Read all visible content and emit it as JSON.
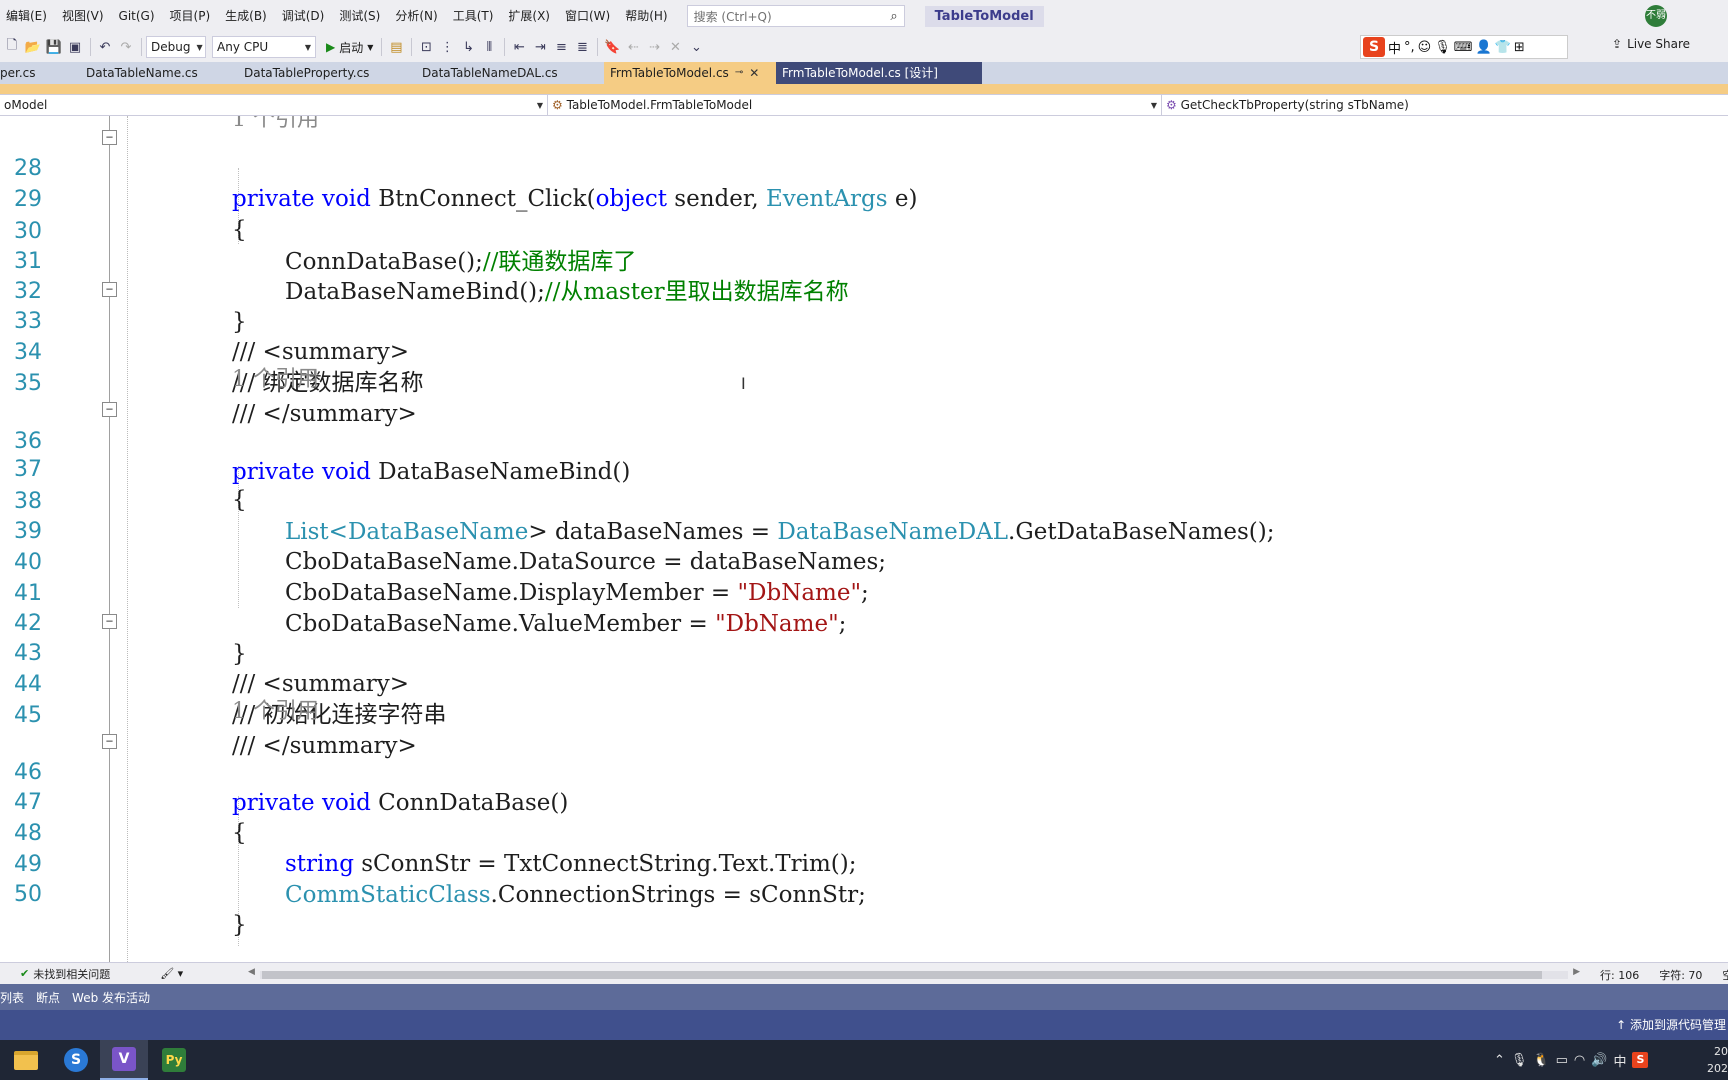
{
  "menubar": {
    "items": [
      "编辑(E)",
      "视图(V)",
      "Git(G)",
      "项目(P)",
      "生成(B)",
      "调试(D)",
      "测试(S)",
      "分析(N)",
      "工具(T)",
      "扩展(X)",
      "窗口(W)",
      "帮助(H)"
    ],
    "search_placeholder": "搜索 (Ctrl+Q)",
    "solution_title": "TableToModel",
    "avatar_text": "不弱"
  },
  "toolbar": {
    "config": "Debug",
    "platform": "Any CPU",
    "start_label": "启动",
    "live_share": "Live Share",
    "ime_mode": "中"
  },
  "tabs": [
    {
      "label": "per.cs"
    },
    {
      "label": "DataTableName.cs"
    },
    {
      "label": "DataTableProperty.cs"
    },
    {
      "label": "DataTableNameDAL.cs"
    },
    {
      "label": "FrmTableToModel.cs"
    },
    {
      "label": "FrmTableToModel.cs [设计]"
    }
  ],
  "navbar": {
    "project": "oModel",
    "class": "TableToModel.FrmTableToModel",
    "member": "GetCheckTbProperty(string sTbName)"
  },
  "code": {
    "top_ref": "1 个引用",
    "refs": [
      "1 个引用",
      "1 个引用"
    ],
    "lines": {
      "28": {
        "num": "28"
      },
      "29": {
        "num": "29"
      },
      "30": {
        "num": "30"
      },
      "31": {
        "num": "31"
      },
      "32": {
        "num": "32"
      },
      "33": {
        "num": "33"
      },
      "34": {
        "num": "34"
      },
      "35": {
        "num": "35"
      },
      "36": {
        "num": "36"
      },
      "37": {
        "num": "37"
      },
      "38": {
        "num": "38"
      },
      "39": {
        "num": "39"
      },
      "40": {
        "num": "40"
      },
      "41": {
        "num": "41"
      },
      "42": {
        "num": "42"
      },
      "43": {
        "num": "43"
      },
      "44": {
        "num": "44"
      },
      "45": {
        "num": "45"
      },
      "46": {
        "num": "46"
      },
      "47": {
        "num": "47"
      },
      "48": {
        "num": "48"
      },
      "49": {
        "num": "49"
      },
      "50": {
        "num": "50"
      }
    },
    "t": {
      "private": "private",
      "void": "void",
      "object": "object",
      "string": "string",
      "btnconnect": "BtnConnect_Click(",
      "sender": " sender, ",
      "eventargs": "EventArgs",
      "e_close": " e)",
      "open_brace": "{",
      "close_brace": "}",
      "conndb_call": "ConnDataBase();",
      "conndb_comment": "//联通数据库了",
      "dbnamebind_call": "DataBaseNameBind();",
      "dbnamebind_comment": "//从master里取出数据库名称",
      "summary_open": "/// <summary>",
      "summary_close": "/// </summary>",
      "doc_bind": "/// 绑定数据库名称",
      "doc_init": "/// 初始化连接字符串",
      "dbnamebind_decl": " DataBaseNameBind()",
      "list": "List<",
      "databasename": "DataBaseName",
      "gt_names": "> dataBaseNames = ",
      "dal": "DataBaseNameDAL",
      "get_names": ".GetDataBaseNames();",
      "datasource": "CboDataBaseName.DataSource = dataBaseNames;",
      "displaymember": "CboDataBaseName.DisplayMember = ",
      "valuemember": "CboDataBaseName.ValueMember = ",
      "dbname_str": "\"DbName\"",
      "semi": ";",
      "conndb_decl": " ConnDataBase()",
      "sconnstr": " sConnStr = TxtConnectString.Text.Trim();",
      "commstatic": "CommStaticClass",
      "connstrings": ".ConnectionStrings = sConnStr;"
    }
  },
  "status": {
    "issues": "未找到相关问题",
    "line": "行: 106",
    "char": "字符: 70",
    "space": "空格"
  },
  "tool_tabs": [
    "列表",
    "断点",
    "Web 发布活动"
  ],
  "vs_status": {
    "add_to_source": "添加到源代码管理"
  },
  "taskbar": {
    "tray_ime": "中",
    "clock_time": "20",
    "clock_date": "202"
  }
}
